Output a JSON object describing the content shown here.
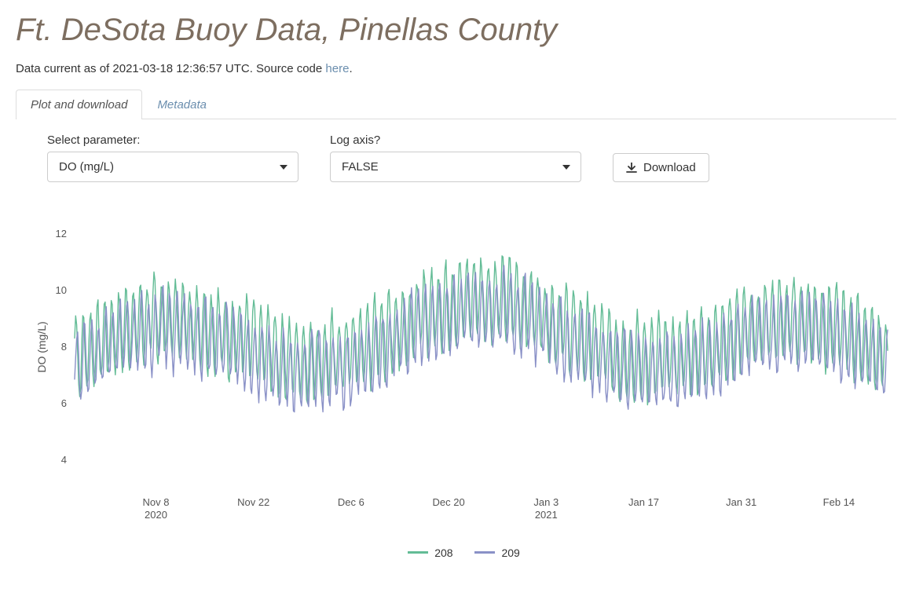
{
  "title": "Ft. DeSota Buoy Data, Pinellas County",
  "subtext_prefix": "Data current as of ",
  "timestamp": "2021-03-18 12:36:57 UTC",
  "subtext_mid": ". Source code ",
  "here_link": "here",
  "subtext_end": ".",
  "tabs": {
    "plot": "Plot and download",
    "meta": "Metadata"
  },
  "controls": {
    "param_label": "Select parameter:",
    "param_value": "DO (mg/L)",
    "log_label": "Log axis?",
    "log_value": "FALSE",
    "download": "Download"
  },
  "chart_data": {
    "type": "line",
    "ylabel": "DO (mg/L)",
    "xlabel": "",
    "ylim": [
      3,
      13
    ],
    "y_ticks": [
      4,
      6,
      8,
      10,
      12
    ],
    "x_ticks": [
      "Nov 8\n2020",
      "Nov 22",
      "Dec 6",
      "Dec 20",
      "Jan 3\n2021",
      "Jan 17",
      "Jan 31",
      "Feb 14"
    ],
    "x_tick_positions": [
      0.1,
      0.22,
      0.34,
      0.46,
      0.58,
      0.7,
      0.82,
      0.94
    ],
    "series": [
      {
        "name": "208",
        "color": "#63bc96"
      },
      {
        "name": "209",
        "color": "#8a91c7"
      }
    ],
    "legend": [
      "208",
      "209"
    ]
  }
}
